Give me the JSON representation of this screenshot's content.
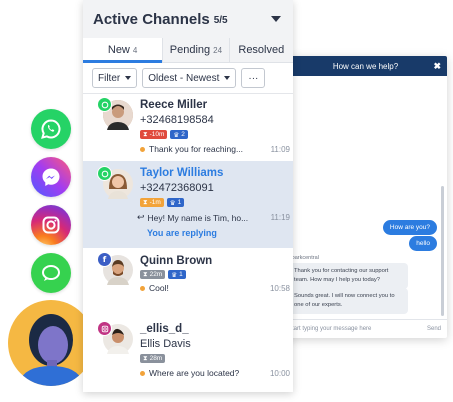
{
  "panel": {
    "title": "Active Channels",
    "count": "5/5",
    "tabs": [
      {
        "label": "New",
        "count": "4"
      },
      {
        "label": "Pending",
        "count": "24"
      },
      {
        "label": "Resolved",
        "count": ""
      }
    ],
    "filters": {
      "filter_label": "Filter",
      "sort_label": "Oldest - Newest",
      "more_label": "···"
    }
  },
  "conversations": [
    {
      "name": "Reece Miller",
      "line2": "+32468198584",
      "channel": "whatsapp-icon",
      "badges": [
        {
          "text": "-10m",
          "color": "#e04a3d",
          "icon": "hourglass-icon"
        },
        {
          "text": "2",
          "color": "#2f66c9",
          "icon": "crown-icon"
        }
      ],
      "preview": "Thank you for reaching...",
      "time": "11:09",
      "preview_icon": "dot"
    },
    {
      "name": "Taylor Williams",
      "line2": "+32472368091",
      "channel": "whatsapp-icon",
      "badges": [
        {
          "text": "-1m",
          "color": "#f2a33a",
          "icon": "hourglass-icon"
        },
        {
          "text": "1",
          "color": "#2f66c9",
          "icon": "crown-icon"
        }
      ],
      "preview": "Hey! My name is Tim, ho...",
      "time": "11:19",
      "preview_icon": "reply-icon",
      "status": "You are replying"
    },
    {
      "name": "Quinn Brown",
      "line2": "",
      "channel": "facebook-icon",
      "badges": [
        {
          "text": "22m",
          "color": "#8a919c",
          "icon": "hourglass-icon"
        },
        {
          "text": "1",
          "color": "#2f66c9",
          "icon": "crown-icon"
        }
      ],
      "preview": "Cool!",
      "time": "10:58",
      "preview_icon": "dot"
    },
    {
      "name": "_ellis_d_",
      "line2": "Ellis Davis",
      "channel": "instagram-icon",
      "badges": [
        {
          "text": "28m",
          "color": "#8a919c",
          "icon": "hourglass-icon"
        }
      ],
      "preview": "Where are you located?",
      "time": "10:00",
      "preview_icon": "dot"
    }
  ],
  "widget": {
    "header": "How can we help?",
    "close": "✖",
    "messages": [
      {
        "side": "right",
        "text": "How are you?"
      },
      {
        "side": "right",
        "text": "hello"
      },
      {
        "side": "agent-name",
        "text": "Sparkcentral"
      },
      {
        "side": "left",
        "text": "Thank you for contacting our support team. How may I help you today?"
      },
      {
        "side": "left",
        "text": "Sounds great. I will now connect you to one of our experts."
      }
    ],
    "input_placeholder": "Start typing your message here",
    "send_label": "Send"
  },
  "social_icons": [
    "whatsapp-icon",
    "messenger-icon",
    "instagram-icon",
    "imessage-icon"
  ],
  "colors": {
    "accent": "#2c7ce0",
    "selected_row": "#dfe6f1",
    "widget_header": "#183a69",
    "agent_avatar": "#f5b843"
  }
}
